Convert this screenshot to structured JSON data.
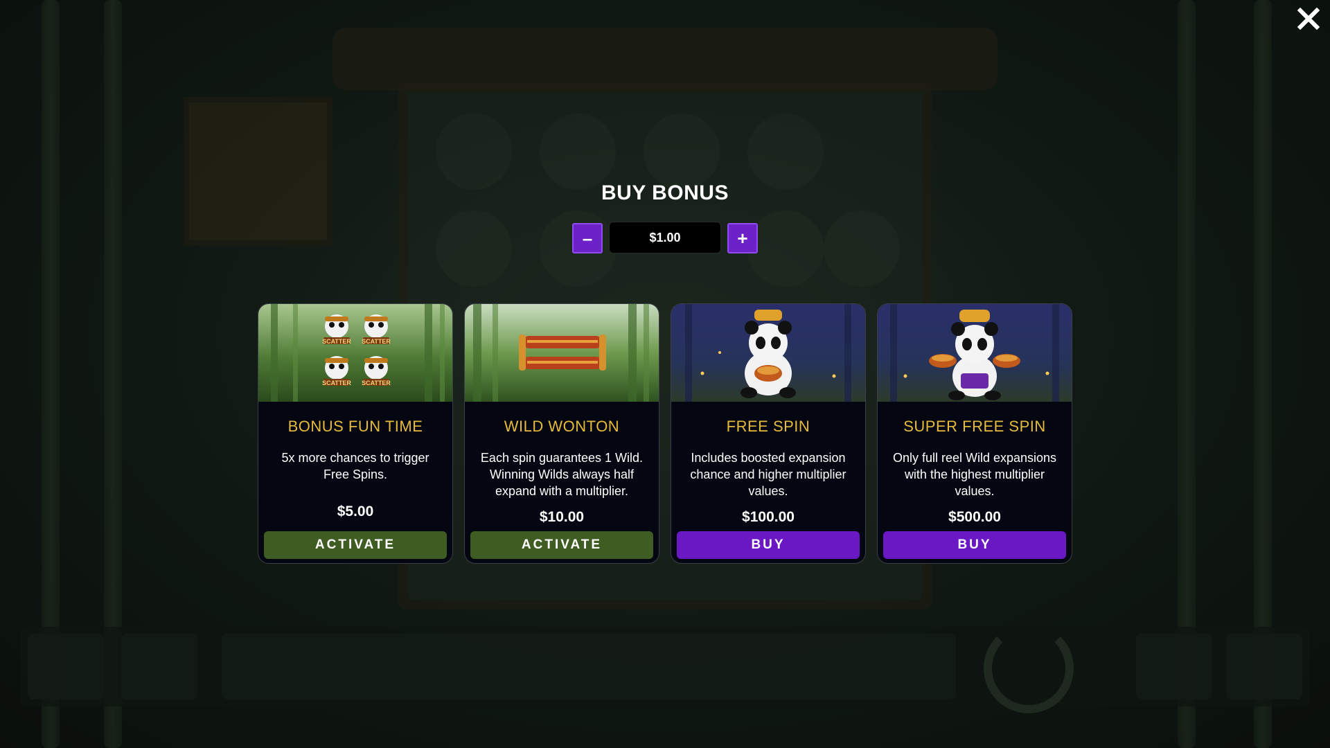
{
  "title": "BUY BONUS",
  "bet_stepper": {
    "minus_label": "–",
    "value": "$1.00",
    "plus_label": "+"
  },
  "close_icon": "close-icon",
  "cards": [
    {
      "title": "BONUS FUN TIME",
      "description": "5x more chances to trigger Free Spins.",
      "price": "$5.00",
      "button": "ACTIVATE",
      "button_color": "#3f5d22",
      "image": "four-panda-scatter-symbols",
      "image_labels": [
        "SCATTER",
        "SCATTER",
        "SCATTER",
        "SCATTER"
      ]
    },
    {
      "title": "WILD WONTON",
      "description": "Each spin guarantees 1 Wild. Winning Wilds always half expand with a multiplier.",
      "price": "$10.00",
      "button": "ACTIVATE",
      "button_color": "#3f5d22",
      "image": "wild-scroll-in-bamboo-forest"
    },
    {
      "title": "FREE SPIN",
      "description": "Includes boosted expansion chance and higher multiplier values.",
      "price": "$100.00",
      "button": "BUY",
      "button_color": "#6a17c4",
      "image": "panda-with-bowl-night"
    },
    {
      "title": "SUPER FREE SPIN",
      "description": "Only full reel Wild expansions with the highest multiplier values.",
      "price": "$500.00",
      "button": "BUY",
      "button_color": "#6a17c4",
      "image": "panda-with-two-bowls-night"
    }
  ],
  "colors": {
    "card_title": "#e7bb3c",
    "stepper_button": "#6d22c8",
    "activate_button": "#3f5d22",
    "buy_button": "#6a17c4"
  }
}
